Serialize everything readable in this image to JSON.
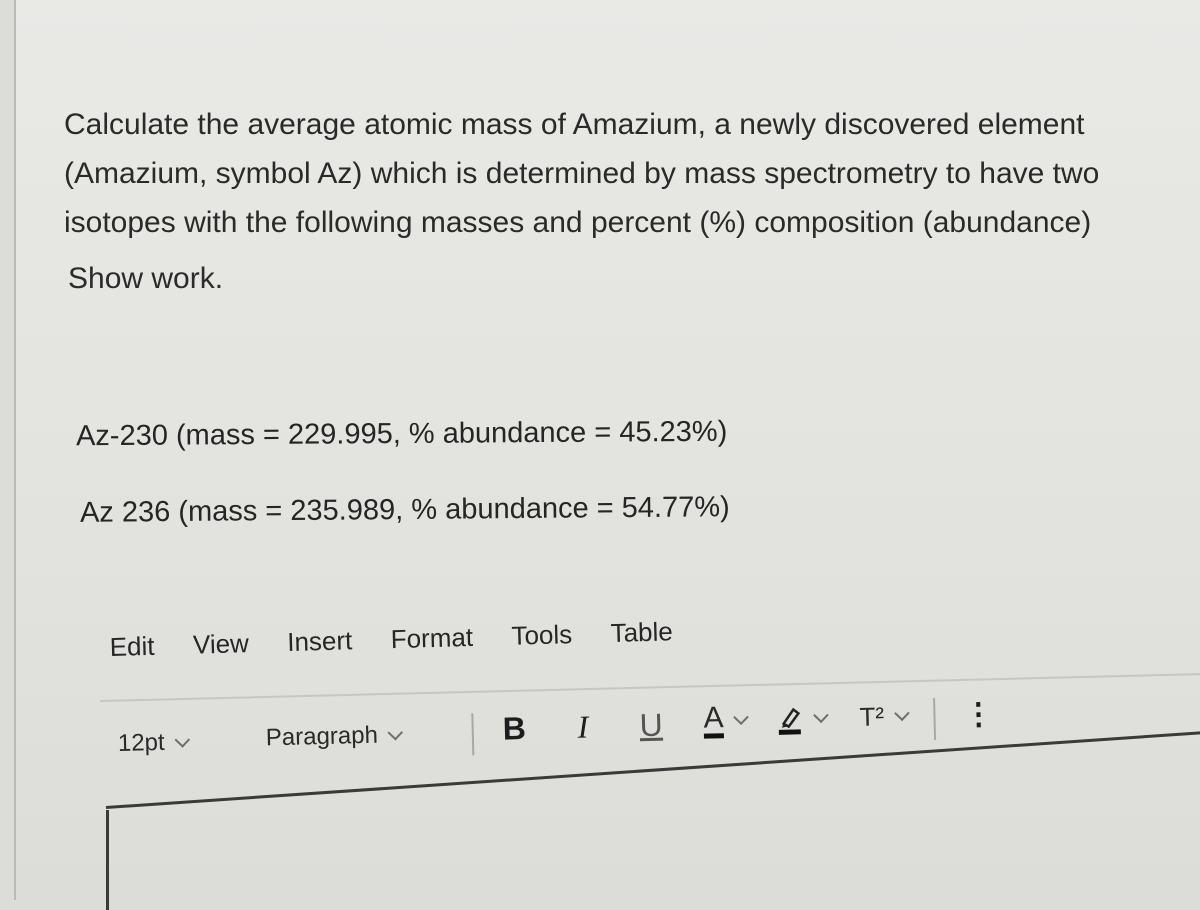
{
  "question": {
    "lines": [
      "Calculate the average atomic mass of Amazium, a newly discovered element",
      "(Amazium, symbol Az) which is determined by mass spectrometry to have two",
      "isotopes with the following masses and percent (%) composition (abundance)"
    ],
    "instruction": "Show work."
  },
  "isotopes": [
    {
      "text": "Az-230  (mass = 229.995, % abundance = 45.23%)",
      "label": "Az-230",
      "mass": 229.995,
      "abundance_percent": 45.23
    },
    {
      "text": "Az 236 (mass = 235.989, % abundance = 54.77%)",
      "label": "Az 236",
      "mass": 235.989,
      "abundance_percent": 54.77
    }
  ],
  "editor": {
    "menu": [
      "Edit",
      "View",
      "Insert",
      "Format",
      "Tools",
      "Table"
    ],
    "font_size": "12pt",
    "block_format": "Paragraph",
    "toolbar": {
      "bold": "B",
      "italic": "I",
      "underline": "U",
      "text_color": "A",
      "superscript": "T²",
      "more": "⋮"
    },
    "answer_value": ""
  }
}
